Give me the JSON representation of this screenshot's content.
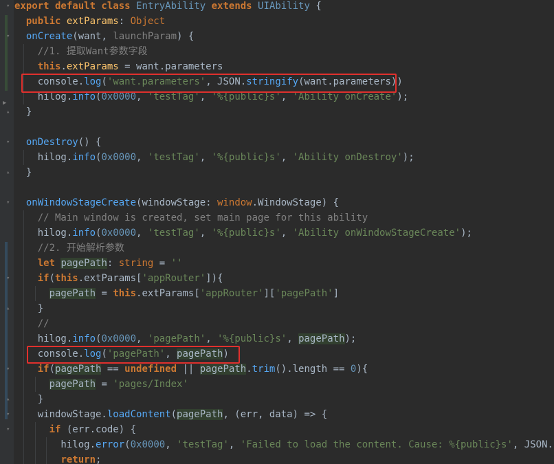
{
  "code_lines": [
    [
      {
        "t": "export default class ",
        "c": "kw"
      },
      {
        "t": "EntryAbility",
        "c": "cls"
      },
      {
        "t": " extends ",
        "c": "kw"
      },
      {
        "t": "UIAbility",
        "c": "cls"
      },
      {
        "t": " {",
        "c": "p"
      }
    ],
    [
      {
        "t": "  "
      },
      {
        "t": "public ",
        "c": "kw"
      },
      {
        "t": "extParams",
        "c": "fn"
      },
      {
        "t": ": "
      },
      {
        "t": "Object",
        "c": "kwn"
      }
    ],
    [
      {
        "t": "  "
      },
      {
        "t": "onCreate",
        "c": "m"
      },
      {
        "t": "(want, "
      },
      {
        "t": "launchParam",
        "c": "cm"
      },
      {
        "t": ") {"
      }
    ],
    [
      {
        "t": "    "
      },
      {
        "t": "//1. 提取Want参数字段",
        "c": "cm"
      }
    ],
    [
      {
        "t": "    "
      },
      {
        "t": "this",
        "c": "kw"
      },
      {
        "t": "."
      },
      {
        "t": "extParams",
        "c": "fn"
      },
      {
        "t": " = want.parameters"
      }
    ],
    [
      {
        "t": "    console."
      },
      {
        "t": "log",
        "c": "m"
      },
      {
        "t": "("
      },
      {
        "t": "'want.parameters'",
        "c": "str"
      },
      {
        "t": ", JSON."
      },
      {
        "t": "stringify",
        "c": "m"
      },
      {
        "t": "(want.parameters))"
      }
    ],
    [
      {
        "t": "    hilog."
      },
      {
        "t": "info",
        "c": "m"
      },
      {
        "t": "("
      },
      {
        "t": "0x0000",
        "c": "num"
      },
      {
        "t": ", "
      },
      {
        "t": "'testTag'",
        "c": "str"
      },
      {
        "t": ", "
      },
      {
        "t": "'%{public}s'",
        "c": "str"
      },
      {
        "t": ", "
      },
      {
        "t": "'Ability onCreate'",
        "c": "str"
      },
      {
        "t": ");"
      }
    ],
    [
      {
        "t": "  }"
      }
    ],
    [
      {
        "t": ""
      }
    ],
    [
      {
        "t": "  "
      },
      {
        "t": "onDestroy",
        "c": "m"
      },
      {
        "t": "() {"
      }
    ],
    [
      {
        "t": "    hilog."
      },
      {
        "t": "info",
        "c": "m"
      },
      {
        "t": "("
      },
      {
        "t": "0x0000",
        "c": "num"
      },
      {
        "t": ", "
      },
      {
        "t": "'testTag'",
        "c": "str"
      },
      {
        "t": ", "
      },
      {
        "t": "'%{public}s'",
        "c": "str"
      },
      {
        "t": ", "
      },
      {
        "t": "'Ability onDestroy'",
        "c": "str"
      },
      {
        "t": ");"
      }
    ],
    [
      {
        "t": "  }"
      }
    ],
    [
      {
        "t": ""
      }
    ],
    [
      {
        "t": "  "
      },
      {
        "t": "onWindowStageCreate",
        "c": "m"
      },
      {
        "t": "(windowStage: "
      },
      {
        "t": "window",
        "c": "kwn"
      },
      {
        "t": ".WindowStage) {"
      }
    ],
    [
      {
        "t": "    "
      },
      {
        "t": "// Main window is created, set main page for this ability",
        "c": "cm"
      }
    ],
    [
      {
        "t": "    hilog."
      },
      {
        "t": "info",
        "c": "m"
      },
      {
        "t": "("
      },
      {
        "t": "0x0000",
        "c": "num"
      },
      {
        "t": ", "
      },
      {
        "t": "'testTag'",
        "c": "str"
      },
      {
        "t": ", "
      },
      {
        "t": "'%{public}s'",
        "c": "str"
      },
      {
        "t": ", "
      },
      {
        "t": "'Ability onWindowStageCreate'",
        "c": "str"
      },
      {
        "t": ");"
      }
    ],
    [
      {
        "t": "    "
      },
      {
        "t": "//2. 开始解析参数",
        "c": "cm"
      }
    ],
    [
      {
        "t": "    "
      },
      {
        "t": "let ",
        "c": "kw"
      },
      {
        "t": "pagePath",
        "c": "hl"
      },
      {
        "t": ": "
      },
      {
        "t": "string",
        "c": "kwn"
      },
      {
        "t": " = "
      },
      {
        "t": "''",
        "c": "str"
      }
    ],
    [
      {
        "t": "    "
      },
      {
        "t": "if",
        "c": "kw"
      },
      {
        "t": "("
      },
      {
        "t": "this",
        "c": "kw"
      },
      {
        "t": ".extParams["
      },
      {
        "t": "'appRouter'",
        "c": "str"
      },
      {
        "t": "]){"
      }
    ],
    [
      {
        "t": "      "
      },
      {
        "t": "pagePath",
        "c": "hl"
      },
      {
        "t": " = "
      },
      {
        "t": "this",
        "c": "kw"
      },
      {
        "t": ".extParams["
      },
      {
        "t": "'appRouter'",
        "c": "str"
      },
      {
        "t": "]["
      },
      {
        "t": "'pagePath'",
        "c": "str"
      },
      {
        "t": "]"
      }
    ],
    [
      {
        "t": "    }"
      }
    ],
    [
      {
        "t": "    "
      },
      {
        "t": "//",
        "c": "cm"
      }
    ],
    [
      {
        "t": "    hilog."
      },
      {
        "t": "info",
        "c": "m"
      },
      {
        "t": "("
      },
      {
        "t": "0x0000",
        "c": "num"
      },
      {
        "t": ", "
      },
      {
        "t": "'pagePath'",
        "c": "str"
      },
      {
        "t": ", "
      },
      {
        "t": "'%{public}s'",
        "c": "str"
      },
      {
        "t": ", "
      },
      {
        "t": "pagePath",
        "c": "hl"
      },
      {
        "t": ");"
      }
    ],
    [
      {
        "t": "    console."
      },
      {
        "t": "log",
        "c": "m"
      },
      {
        "t": "("
      },
      {
        "t": "'pagePath'",
        "c": "str"
      },
      {
        "t": ", "
      },
      {
        "t": "pagePath",
        "c": "hl"
      },
      {
        "t": ")"
      }
    ],
    [
      {
        "t": "    "
      },
      {
        "t": "if",
        "c": "kw"
      },
      {
        "t": "("
      },
      {
        "t": "pagePath",
        "c": "hl"
      },
      {
        "t": " == "
      },
      {
        "t": "undefined",
        "c": "kw"
      },
      {
        "t": " || "
      },
      {
        "t": "pagePath",
        "c": "hl"
      },
      {
        "t": "."
      },
      {
        "t": "trim",
        "c": "m"
      },
      {
        "t": "().length == "
      },
      {
        "t": "0",
        "c": "num"
      },
      {
        "t": "){"
      }
    ],
    [
      {
        "t": "      "
      },
      {
        "t": "pagePath",
        "c": "hl"
      },
      {
        "t": " = "
      },
      {
        "t": "'pages/Index'",
        "c": "str"
      }
    ],
    [
      {
        "t": "    }"
      }
    ],
    [
      {
        "t": "    windowStage."
      },
      {
        "t": "loadContent",
        "c": "m"
      },
      {
        "t": "("
      },
      {
        "t": "pagePath",
        "c": "hl"
      },
      {
        "t": ", (err, data) => {"
      }
    ],
    [
      {
        "t": "      "
      },
      {
        "t": "if ",
        "c": "kw"
      },
      {
        "t": "(err.code) {"
      }
    ],
    [
      {
        "t": "        hilog."
      },
      {
        "t": "error",
        "c": "m"
      },
      {
        "t": "("
      },
      {
        "t": "0x0000",
        "c": "num"
      },
      {
        "t": ", "
      },
      {
        "t": "'testTag'",
        "c": "str"
      },
      {
        "t": ", "
      },
      {
        "t": "'Failed to load the content. Cause: %{public}s'",
        "c": "str"
      },
      {
        "t": ", JSON.string"
      }
    ],
    [
      {
        "t": "        "
      },
      {
        "t": "return",
        "c": "kw"
      },
      {
        "t": ";"
      }
    ]
  ]
}
